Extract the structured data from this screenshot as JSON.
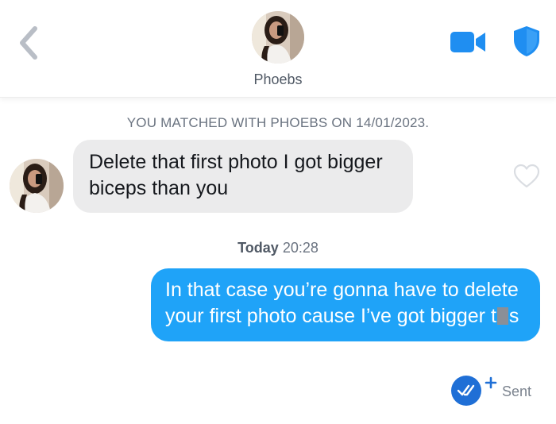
{
  "header": {
    "name": "Phoebs",
    "icons": [
      "back-chevron-icon",
      "video-camera-icon",
      "shield-icon"
    ],
    "accent_color": "#1f8ef1"
  },
  "conversation": {
    "match_note": "YOU MATCHED WITH PHOEBS ON 14/01/2023.",
    "incoming": {
      "text": "Delete that first photo I got bigger biceps than you",
      "bubble_color": "#ebebec"
    },
    "timestamp_day": "Today",
    "timestamp_time": "20:28",
    "outgoing": {
      "text_before": "In that case you’re gonna have to delete your first photo cause I’ve got bigger t",
      "text_after": "s",
      "bubble_color": "#1fa3f8"
    },
    "status": "Sent"
  }
}
